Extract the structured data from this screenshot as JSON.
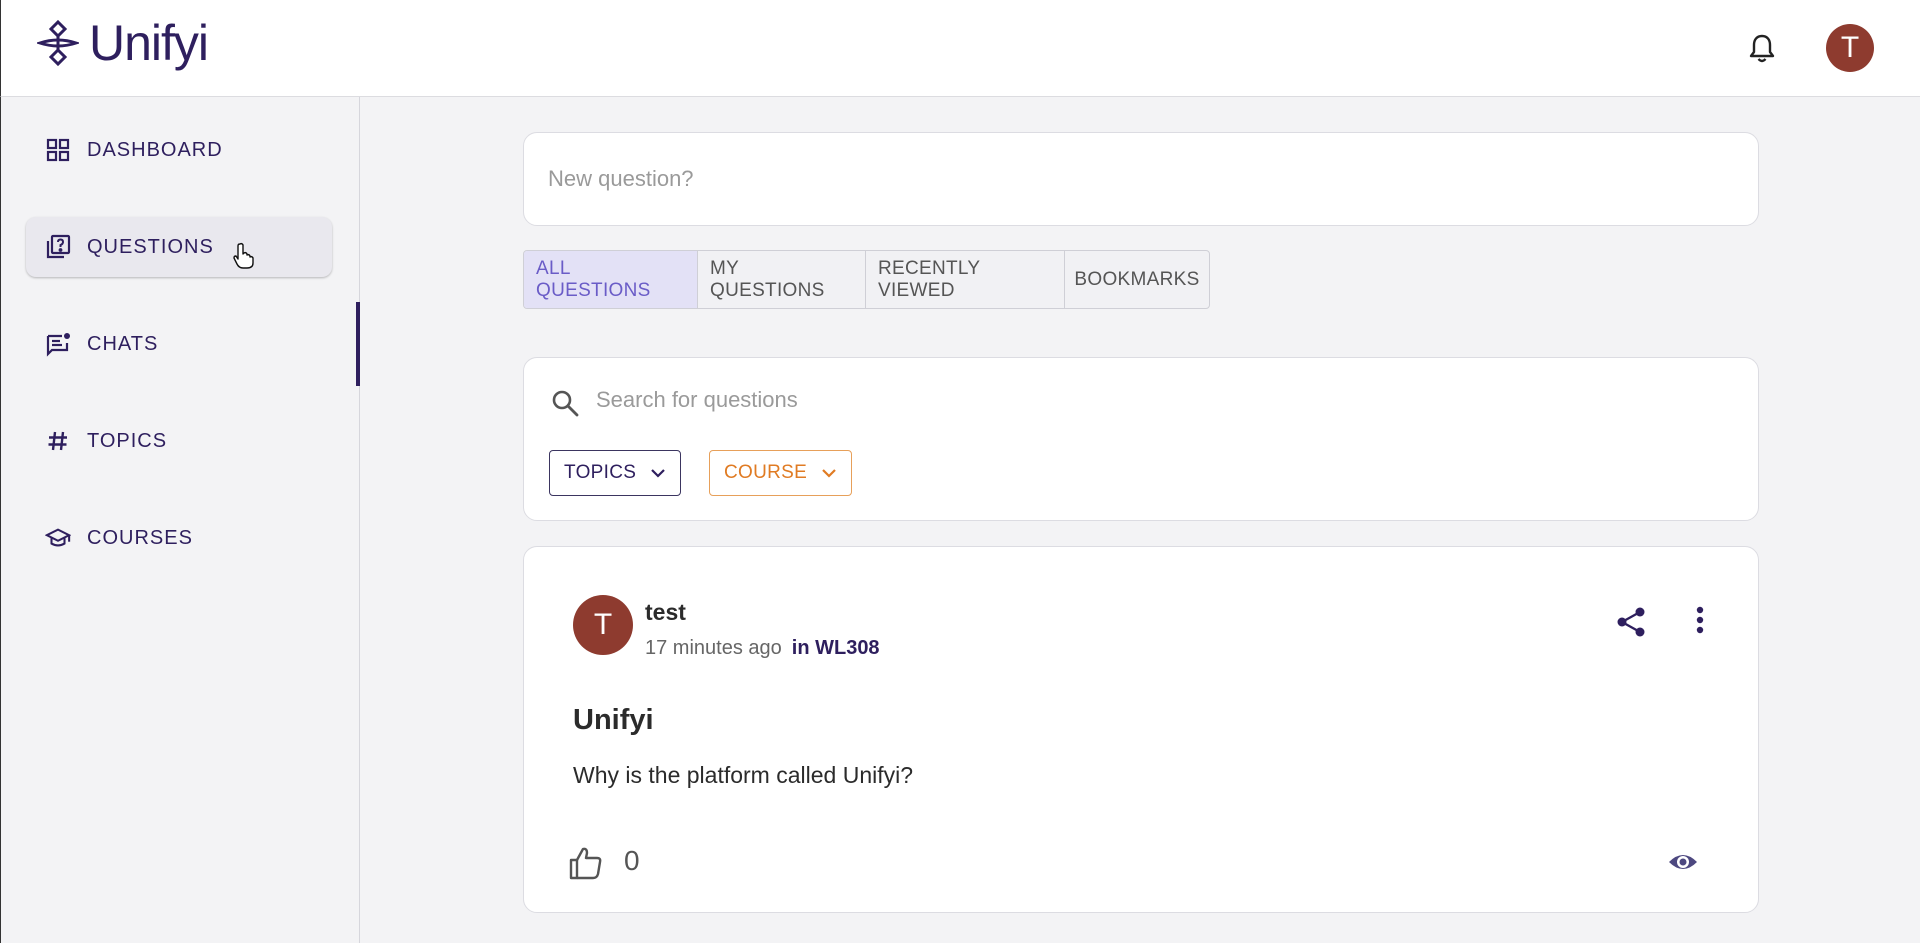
{
  "app": {
    "name": "Unifyi"
  },
  "header": {
    "avatar_initial": "T"
  },
  "sidebar": {
    "items": [
      {
        "label": "DASHBOARD",
        "icon": "grid-icon"
      },
      {
        "label": "QUESTIONS",
        "icon": "question-book-icon",
        "active": true
      },
      {
        "label": "CHATS",
        "icon": "chat-icon"
      },
      {
        "label": "TOPICS",
        "icon": "hashtag-icon"
      },
      {
        "label": "COURSES",
        "icon": "graduation-cap-icon"
      }
    ]
  },
  "new_question": {
    "placeholder": "New question?"
  },
  "tabs": [
    {
      "label": "ALL QUESTIONS",
      "active": true
    },
    {
      "label": "MY QUESTIONS"
    },
    {
      "label": "RECENTLY VIEWED"
    },
    {
      "label": "BOOKMARKS"
    }
  ],
  "search": {
    "placeholder": "Search for questions",
    "filters": {
      "topics": "TOPICS",
      "course": "COURSE"
    }
  },
  "post": {
    "avatar_initial": "T",
    "author": "test",
    "time": "17 minutes ago",
    "course": "in WL308",
    "title": "Unifyi",
    "body": "Why is the platform called Unifyi?",
    "likes": "0"
  },
  "colors": {
    "brand": "#2e1f5e",
    "avatar": "#8e3b2f",
    "active_tab_bg": "#e3e1f6",
    "active_tab_text": "#6a5cc7",
    "course_filter": "#e07b23"
  }
}
